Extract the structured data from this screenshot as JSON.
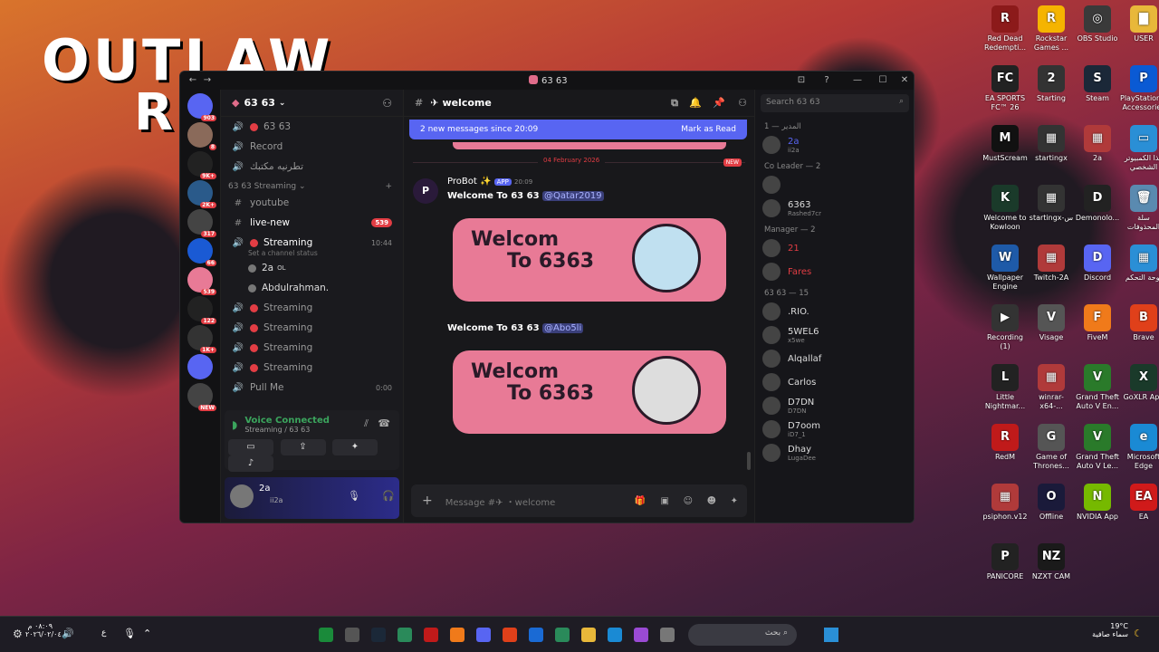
{
  "wallpaper": {
    "text1": "OUTLAW",
    "text2": "R"
  },
  "desktop_icons": [
    {
      "label": "Red Dead Redempti...",
      "color": "#8c1a1a",
      "glyph": "R"
    },
    {
      "label": "Rockstar Games ...",
      "color": "#f5b400",
      "glyph": "R"
    },
    {
      "label": "OBS Studio",
      "color": "#3a3a3a",
      "glyph": "◎"
    },
    {
      "label": "USER",
      "color": "#e8b83a",
      "glyph": "▇"
    },
    {
      "label": "EA SPORTS FC™ 26",
      "color": "#222",
      "glyph": "FC"
    },
    {
      "label": "Starting",
      "color": "#333",
      "glyph": "2"
    },
    {
      "label": "Steam",
      "color": "#1b2838",
      "glyph": "S"
    },
    {
      "label": "PlayStation® Accessories",
      "color": "#0a5ad4",
      "glyph": "P"
    },
    {
      "label": "MustScream",
      "color": "#111",
      "glyph": "M"
    },
    {
      "label": "startingx",
      "color": "#333",
      "glyph": "▦"
    },
    {
      "label": "2a",
      "color": "#b03a3a",
      "glyph": "▦"
    },
    {
      "label": "هذا الكمبيوتر الشخصي",
      "color": "#2a8fd6",
      "glyph": "▭"
    },
    {
      "label": "Welcome to Kowloon",
      "color": "#1a3a2a",
      "glyph": "K"
    },
    {
      "label": "startingx-س",
      "color": "#333",
      "glyph": "▦"
    },
    {
      "label": "Demonolo...",
      "color": "#222",
      "glyph": "D"
    },
    {
      "label": "سلة المحذوفات",
      "color": "#5a8ab0",
      "glyph": "🗑"
    },
    {
      "label": "Wallpaper Engine",
      "color": "#1e5aa8",
      "glyph": "W"
    },
    {
      "label": "Twitch-2A",
      "color": "#b03a3a",
      "glyph": "▦"
    },
    {
      "label": "Discord",
      "color": "#5865f2",
      "glyph": "D"
    },
    {
      "label": "لوحة التحكم",
      "color": "#2a8fd6",
      "glyph": "▦"
    },
    {
      "label": "Recording (1)",
      "color": "#333",
      "glyph": "▶"
    },
    {
      "label": "Visage",
      "color": "#555",
      "glyph": "V"
    },
    {
      "label": "FiveM",
      "color": "#f07a1a",
      "glyph": "F"
    },
    {
      "label": "Brave",
      "color": "#e0401a",
      "glyph": "B"
    },
    {
      "label": "Little Nightmar...",
      "color": "#222",
      "glyph": "L"
    },
    {
      "label": "winrar-x64-...",
      "color": "#b03a3a",
      "glyph": "▦"
    },
    {
      "label": "Grand Theft Auto V En...",
      "color": "#2a7a2a",
      "glyph": "V"
    },
    {
      "label": "GoXLR App",
      "color": "#1a3a2a",
      "glyph": "X"
    },
    {
      "label": "RedM",
      "color": "#c01a1a",
      "glyph": "R"
    },
    {
      "label": "Game of Thrones...",
      "color": "#555",
      "glyph": "G"
    },
    {
      "label": "Grand Theft Auto V Le...",
      "color": "#2a7a2a",
      "glyph": "V"
    },
    {
      "label": "Microsoft Edge",
      "color": "#1a8ad4",
      "glyph": "e"
    },
    {
      "label": "psiphon.v12",
      "color": "#b03a3a",
      "glyph": "▦"
    },
    {
      "label": "Offline",
      "color": "#1a1a3a",
      "glyph": "O"
    },
    {
      "label": "NVIDIA App",
      "color": "#76b900",
      "glyph": "N"
    },
    {
      "label": "EA",
      "color": "#d01a1a",
      "glyph": "EA"
    },
    {
      "label": "PANICORE",
      "color": "#222",
      "glyph": "P"
    },
    {
      "label": "NZXT CAM",
      "color": "#1a1a1a",
      "glyph": "NZ"
    }
  ],
  "window": {
    "title": "63 63"
  },
  "servers": [
    {
      "badge": "903",
      "color": "#5865f2"
    },
    {
      "badge": "8",
      "color": "#8a6a5a"
    },
    {
      "badge": "9K+",
      "color": "#222"
    },
    {
      "badge": "2K+",
      "color": "#2a5a8a"
    },
    {
      "badge": "317",
      "color": "#444"
    },
    {
      "badge": "66",
      "color": "#1a5ad4"
    },
    {
      "badge": "539",
      "color": "#e87a96"
    },
    {
      "badge": "122",
      "color": "#222"
    },
    {
      "badge": "1K+",
      "color": "#333"
    },
    {
      "badge": "",
      "color": "#5865f2"
    },
    {
      "badge": "NEW",
      "color": "#444"
    }
  ],
  "channels": {
    "server_name": "63 63",
    "items_top": [
      {
        "label": "63 63",
        "kind": "voice-dot"
      },
      {
        "label": "Record",
        "kind": "voice"
      },
      {
        "label": "تطرنيه مكتبك",
        "kind": "voice"
      }
    ],
    "category": "63 63 Streaming",
    "items": [
      {
        "label": "youtube",
        "kind": "text",
        "active": false
      },
      {
        "label": "live-new",
        "kind": "text",
        "active": true,
        "badge": "539"
      },
      {
        "label": "Streaming",
        "kind": "voice-dot",
        "active": true,
        "time": "10:44",
        "status": "Set a channel status"
      },
      {
        "label": "Streaming",
        "kind": "voice-dot"
      },
      {
        "label": "Streaming",
        "kind": "voice-dot"
      },
      {
        "label": "Streaming",
        "kind": "voice-dot"
      },
      {
        "label": "Streaming",
        "kind": "voice-dot"
      },
      {
        "label": "Pull Me",
        "kind": "voice",
        "time": "0:00"
      }
    ],
    "voice_users": [
      {
        "name": "2a",
        "tag": "OL"
      },
      {
        "name": "Abdulrahman.",
        "tag": ""
      }
    ]
  },
  "voice": {
    "title": "Voice Connected",
    "sub": "Streaming / 63 63"
  },
  "user": {
    "name": "2a",
    "status": "ii2a"
  },
  "chat": {
    "channel": "welcome",
    "newbar": "2 new messages since 20:09",
    "markread": "Mark as Read",
    "date": "04 February 2026",
    "new_tag": "NEW",
    "author": "ProBot",
    "app": "APP",
    "time": "20:09",
    "msg1": "Welcome To 63 63",
    "mention1": "@Qatar2019",
    "msg2": "Welcome To 63 63",
    "mention2": "@Abo5li",
    "card_line1": "Welcom",
    "card_line2": "To 6363",
    "input_placeholder": "Message #✈ ・welcome"
  },
  "search": {
    "placeholder": "Search 63 63"
  },
  "members": {
    "groups": [
      {
        "title": "المدير — 1",
        "members": [
          {
            "name": "2a",
            "sub": "ii2a",
            "color": "#5865f2"
          }
        ]
      },
      {
        "title": "Co Leader — 2",
        "members": [
          {
            "name": "",
            "sub": "",
            "color": "#ddd"
          },
          {
            "name": "6363",
            "sub": "Rashed7cr",
            "color": "#ddd"
          }
        ]
      },
      {
        "title": "Manager — 2",
        "members": [
          {
            "name": "21",
            "sub": "",
            "color": "#e23d44"
          },
          {
            "name": "Fares",
            "sub": "",
            "color": "#e23d44"
          }
        ]
      },
      {
        "title": "63 63 — 15",
        "members": [
          {
            "name": ".RIO.",
            "sub": "",
            "color": "#ddd"
          },
          {
            "name": "5WEL6",
            "sub": "x5we",
            "color": "#ddd"
          },
          {
            "name": "Alqallaf",
            "sub": "",
            "color": "#ddd"
          },
          {
            "name": "Carlos",
            "sub": "",
            "color": "#ddd"
          },
          {
            "name": "D7DN",
            "sub": "D7DN",
            "color": "#ddd"
          },
          {
            "name": "D7oom",
            "sub": "iD7_1",
            "color": "#ddd"
          },
          {
            "name": "Dhay",
            "sub": "LugaDee",
            "color": "#ddd"
          }
        ]
      }
    ]
  },
  "taskbar": {
    "search": "بحث",
    "temp": "19°C",
    "weather": "سماء صافية",
    "time": "٠٨:٠٩ م",
    "date": "٢٠٢٦/٠٢/٠٤",
    "lang": "ع"
  }
}
